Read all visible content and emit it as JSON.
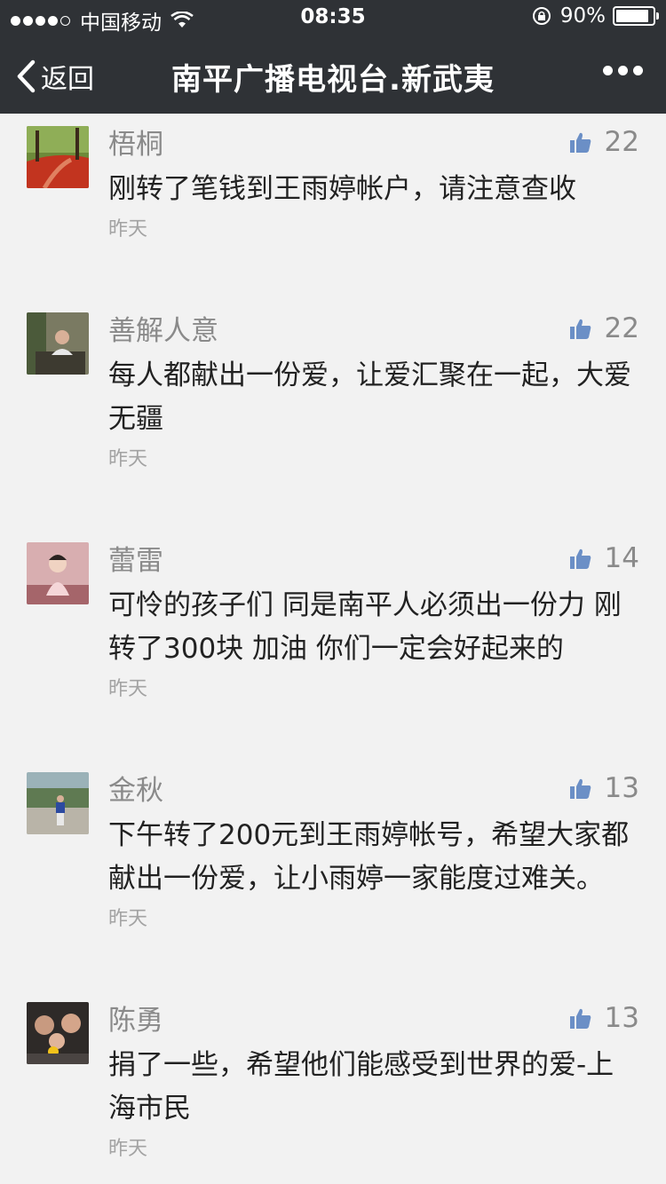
{
  "status_bar": {
    "carrier": "中国移动",
    "time": "08:35",
    "battery": "90%",
    "battery_level": 0.9
  },
  "nav": {
    "back_label": "返回",
    "title": "南平广播电视台.新武夷"
  },
  "comments": [
    {
      "name": "梧桐",
      "likes": "22",
      "text": "刚转了笔钱到王雨婷帐户，请注意查收",
      "date": "昨天",
      "avatar_color": "#b43a2a"
    },
    {
      "name": "善解人意",
      "likes": "22",
      "text": "每人都献出一份爱，让爱汇聚在一起，大爱无疆",
      "date": "昨天",
      "avatar_color": "#5a5a48"
    },
    {
      "name": "蕾雷",
      "likes": "14",
      "text": "可怜的孩子们 同是南平人必须出一份力 刚转了300块 加油 你们一定会好起来的",
      "date": "昨天",
      "avatar_color": "#e8c6c8"
    },
    {
      "name": "金秋",
      "likes": "13",
      "text": "下午转了200元到王雨婷帐号，希望大家都献出一份爱，让小雨婷一家能度过难关。",
      "date": "昨天",
      "avatar_color": "#7e9a6a"
    },
    {
      "name": "陈勇",
      "likes": "13",
      "text": "捐了一些，希望他们能感受到世界的爱-上海市民",
      "date": "昨天",
      "avatar_color": "#3a3432"
    }
  ],
  "icons": {
    "back": "chevron-left-icon",
    "more": "more-dots-icon",
    "like": "thumbs-up-icon"
  },
  "colors": {
    "nav_bg": "#2f3236",
    "like_icon": "#6b8fc6",
    "page_bg": "#f2f2f2"
  }
}
